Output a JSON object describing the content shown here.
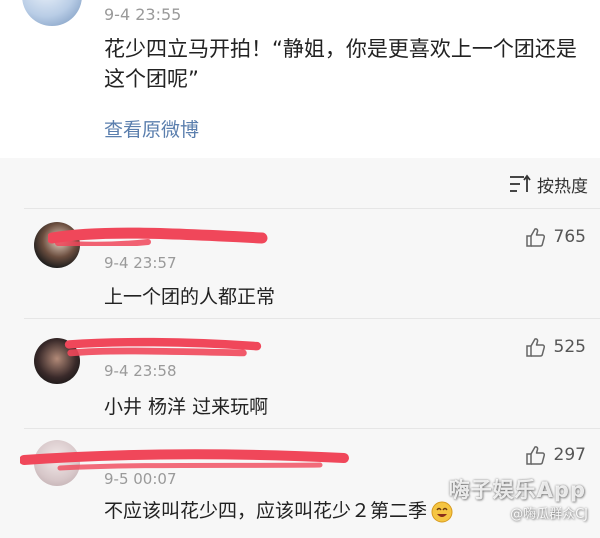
{
  "post": {
    "time": "9-4 23:55",
    "text": "花少四立马开拍！“静姐，你是更喜欢上一个团还是这个团呢”",
    "view_original": "查看原微博"
  },
  "sort": {
    "label": "按热度",
    "icon": "sort-lines-icon"
  },
  "comments": [
    {
      "time": "9-4 23:57",
      "text": "上一个团的人都正常",
      "likes": "765"
    },
    {
      "time": "9-4 23:58",
      "text": "小井 杨洋 过来玩啊",
      "likes": "525"
    },
    {
      "time": "9-5 00:07",
      "text": "不应该叫花少四，应该叫花少２第二季",
      "likes": "297"
    }
  ],
  "watermark": {
    "app": "嗨子娱乐App",
    "weibo": "@嗨瓜群众CJ"
  },
  "colors": {
    "link": "#5b7fae",
    "redaction": "#f0475a",
    "background": "#f7f7f7"
  }
}
